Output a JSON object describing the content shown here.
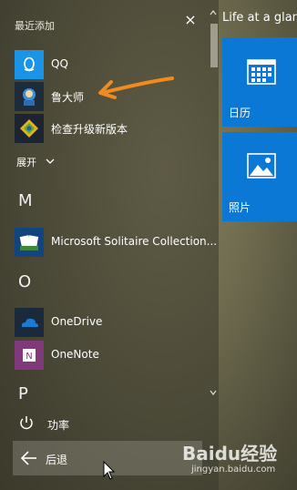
{
  "start_menu": {
    "recent_header": "最近添加",
    "recent_items": [
      {
        "label": "QQ",
        "icon": "qq-icon",
        "color": "#1a94e6"
      },
      {
        "label": "鲁大师",
        "icon": "ludashi-icon",
        "color": "#1d2b3a"
      },
      {
        "label": "检查升级新版本",
        "icon": "update-icon",
        "color": "#1b2430"
      }
    ],
    "expand_label": "展开",
    "sections": [
      {
        "letter": "M",
        "items": [
          {
            "label": "Microsoft Solitaire Collection...",
            "icon": "solitaire-icon",
            "color": "#12447f"
          }
        ]
      },
      {
        "letter": "O",
        "items": [
          {
            "label": "OneDrive",
            "icon": "onedrive-icon",
            "color": "#1b2a3a"
          },
          {
            "label": "OneNote",
            "icon": "onenote-icon",
            "color": "#80397b"
          }
        ]
      },
      {
        "letter": "P",
        "items": []
      }
    ],
    "power_label": "功率",
    "back_label": "后退"
  },
  "tiles": {
    "group_header": "Life at a glance",
    "items": [
      {
        "label": "日历",
        "icon": "calendar-icon",
        "color": "#0a78d4"
      },
      {
        "label": "照片",
        "icon": "photos-icon",
        "color": "#0a78d4"
      }
    ]
  },
  "watermark": {
    "brand": "Baidu经验",
    "url": "jingyan.baidu.com"
  }
}
